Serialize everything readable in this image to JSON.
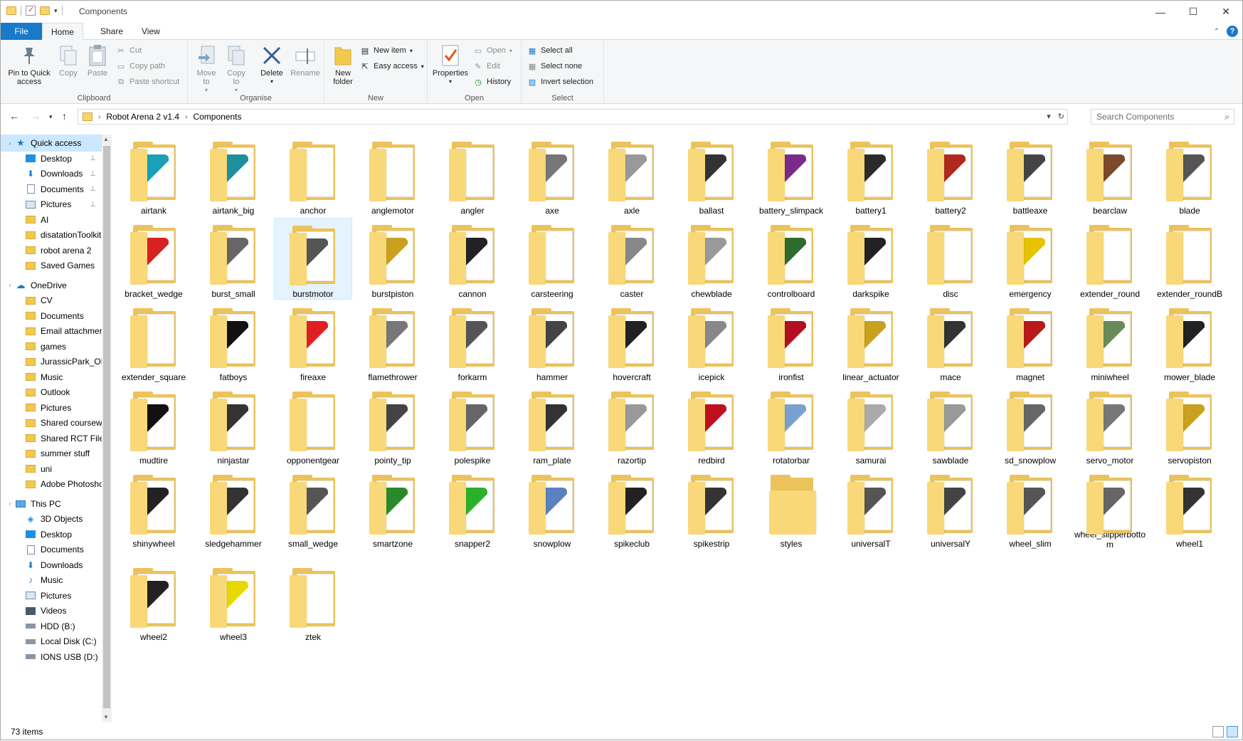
{
  "window": {
    "title": "Components",
    "controls": {
      "minimize": "—",
      "maximize": "☐",
      "close": "✕"
    }
  },
  "ribbon": {
    "tabs": {
      "file": "File",
      "home": "Home",
      "share": "Share",
      "view": "View"
    },
    "clipboard": {
      "label": "Clipboard",
      "pin": "Pin to Quick access",
      "copy": "Copy",
      "paste": "Paste",
      "cut": "Cut",
      "copy_path": "Copy path",
      "paste_shortcut": "Paste shortcut"
    },
    "organise": {
      "label": "Organise",
      "move_to": "Move to",
      "copy_to": "Copy to",
      "delete": "Delete",
      "rename": "Rename"
    },
    "new": {
      "label": "New",
      "new_folder": "New folder",
      "new_item": "New item",
      "easy_access": "Easy access"
    },
    "open": {
      "label": "Open",
      "properties": "Properties",
      "open": "Open",
      "edit": "Edit",
      "history": "History"
    },
    "select": {
      "label": "Select",
      "select_all": "Select all",
      "select_none": "Select none",
      "invert_selection": "Invert selection"
    }
  },
  "address": {
    "crumbs": [
      "Robot Arena 2 v1.4",
      "Components"
    ],
    "search_placeholder": "Search Components"
  },
  "sidebar": {
    "quick_access": "Quick access",
    "quick_items": [
      "Desktop",
      "Downloads",
      "Documents",
      "Pictures",
      "AI",
      "disatationToolkit",
      "robot arena 2",
      "Saved Games"
    ],
    "onedrive": "OneDrive",
    "onedrive_items": [
      "CV",
      "Documents",
      "Email attachments",
      "games",
      "JurassicPark_OP",
      "Music",
      "Outlook",
      "Pictures",
      "Shared coursework",
      "Shared RCT Files",
      "summer stuff",
      "uni",
      "Adobe Photoshop"
    ],
    "this_pc": "This PC",
    "pc_items": [
      "3D Objects",
      "Desktop",
      "Documents",
      "Downloads",
      "Music",
      "Pictures",
      "Videos",
      "HDD (B:)",
      "Local Disk (C:)",
      "IONS USB (D:)"
    ]
  },
  "items": [
    "airtank",
    "airtank_big",
    "anchor",
    "anglemotor",
    "angler",
    "axe",
    "axle",
    "ballast",
    "battery_slimpack",
    "battery1",
    "battery2",
    "battleaxe",
    "bearclaw",
    "blade",
    "bracket_wedge",
    "burst_small",
    "burstmotor",
    "burstpiston",
    "cannon",
    "carsteering",
    "caster",
    "chewblade",
    "controlboard",
    "darkspike",
    "disc",
    "emergency",
    "extender_round",
    "extender_roundB",
    "extender_square",
    "fatboys",
    "fireaxe",
    "flamethrower",
    "forkarm",
    "hammer",
    "hovercraft",
    "icepick",
    "ironfist",
    "linear_actuator",
    "mace",
    "magnet",
    "miniwheel",
    "mower_blade",
    "mudtire",
    "ninjastar",
    "opponentgear",
    "pointy_tip",
    "polespike",
    "ram_plate",
    "razortip",
    "redbird",
    "rotatorbar",
    "samurai",
    "sawblade",
    "sd_snowplow",
    "servo_motor",
    "servopiston",
    "shinywheel",
    "sledgehammer",
    "small_wedge",
    "smartzone",
    "snapper2",
    "snowplow",
    "spikeclub",
    "spikestrip",
    "styles",
    "universalT",
    "universalY",
    "wheel_slim",
    "wheel_slipperbottom",
    "wheel1",
    "wheel2",
    "wheel3",
    "ztek"
  ],
  "thumbs": {
    "airtank": "#1aa0b8",
    "airtank_big": "#1e8f9c",
    "axe": "#777",
    "axle": "#999",
    "ballast": "#333",
    "battery_slimpack": "#7a2a8a",
    "battery1": "#2b2b2b",
    "battery2": "#b0281e",
    "battleaxe": "#444",
    "bearclaw": "#7a4a2a",
    "blade": "#555",
    "bracket_wedge": "#d62222",
    "burst_small": "#666",
    "burstmotor": "#555",
    "burstpiston": "#c9a020",
    "cannon": "#222",
    "caster": "#888",
    "chewblade": "#999",
    "controlboard": "#2e6b2e",
    "darkspike": "#222",
    "emergency": "#e6c200",
    "fatboys": "#111",
    "fireaxe": "#e02020",
    "flamethrower": "#777",
    "forkarm": "#555",
    "hammer": "#444",
    "hovercraft": "#222",
    "icepick": "#888",
    "ironfist": "#b01020",
    "linear_actuator": "#c9a020",
    "mace": "#333",
    "magnet": "#b81a1a",
    "miniwheel": "#6a8a5a",
    "mower_blade": "#222",
    "mudtire": "#111",
    "ninjastar": "#333",
    "pointy_tip": "#444",
    "polespike": "#666",
    "ram_plate": "#333",
    "razortip": "#999",
    "redbird": "#c01020",
    "rotatorbar": "#7aa0d0",
    "samurai": "#aaa",
    "sawblade": "#999",
    "sd_snowplow": "#666",
    "servo_motor": "#777",
    "servopiston": "#c9a020",
    "shinywheel": "#222",
    "sledgehammer": "#333",
    "small_wedge": "#555",
    "smartzone": "#2a8a2a",
    "snapper2": "#2ab02a",
    "snowplow": "#5a80c0",
    "spikeclub": "#222",
    "spikestrip": "#333",
    "universalT": "#555",
    "universalY": "#444",
    "wheel_slim": "#555",
    "wheel_slipperbottom": "#666",
    "wheel1": "#333",
    "wheel2": "#222",
    "wheel3": "#e6d800"
  },
  "status": {
    "count": "73 items"
  }
}
